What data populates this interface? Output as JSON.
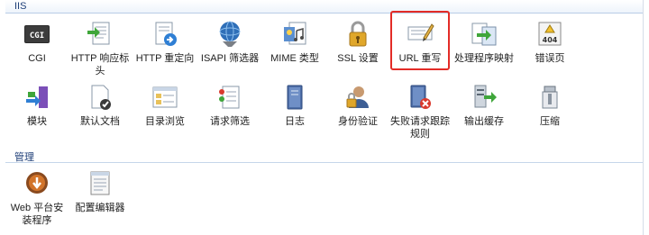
{
  "sections": {
    "iis": {
      "title": "IIS"
    },
    "manage": {
      "title": "管理"
    }
  },
  "iis_items": [
    {
      "label": "CGI",
      "icon": "cgi-icon"
    },
    {
      "label": "HTTP 响应标头",
      "icon": "http-response-headers-icon"
    },
    {
      "label": "HTTP 重定向",
      "icon": "http-redirect-icon"
    },
    {
      "label": "ISAPI 筛选器",
      "icon": "isapi-filters-icon"
    },
    {
      "label": "MIME 类型",
      "icon": "mime-types-icon"
    },
    {
      "label": "SSL 设置",
      "icon": "ssl-settings-icon"
    },
    {
      "label": "URL 重写",
      "icon": "url-rewrite-icon"
    },
    {
      "label": "处理程序映射",
      "icon": "handler-mappings-icon"
    },
    {
      "label": "错误页",
      "icon": "error-pages-icon"
    },
    {
      "label": "模块",
      "icon": "modules-icon"
    },
    {
      "label": "默认文档",
      "icon": "default-document-icon"
    },
    {
      "label": "目录浏览",
      "icon": "directory-browsing-icon"
    },
    {
      "label": "请求筛选",
      "icon": "request-filtering-icon"
    },
    {
      "label": "日志",
      "icon": "logging-icon"
    },
    {
      "label": "身份验证",
      "icon": "authentication-icon"
    },
    {
      "label": "失败请求跟踪规则",
      "icon": "failed-request-tracing-icon"
    },
    {
      "label": "输出缓存",
      "icon": "output-caching-icon"
    },
    {
      "label": "压缩",
      "icon": "compression-icon"
    }
  ],
  "manage_items": [
    {
      "label": "Web 平台安装程序",
      "icon": "web-platform-installer-icon"
    },
    {
      "label": "配置编辑器",
      "icon": "configuration-editor-icon"
    }
  ],
  "error_page_badge": "404",
  "cgi_badge": "CGI",
  "selected_item": "URL 重写",
  "colors": {
    "highlight_border": "#e32c27",
    "section_title": "#1f3f78"
  }
}
